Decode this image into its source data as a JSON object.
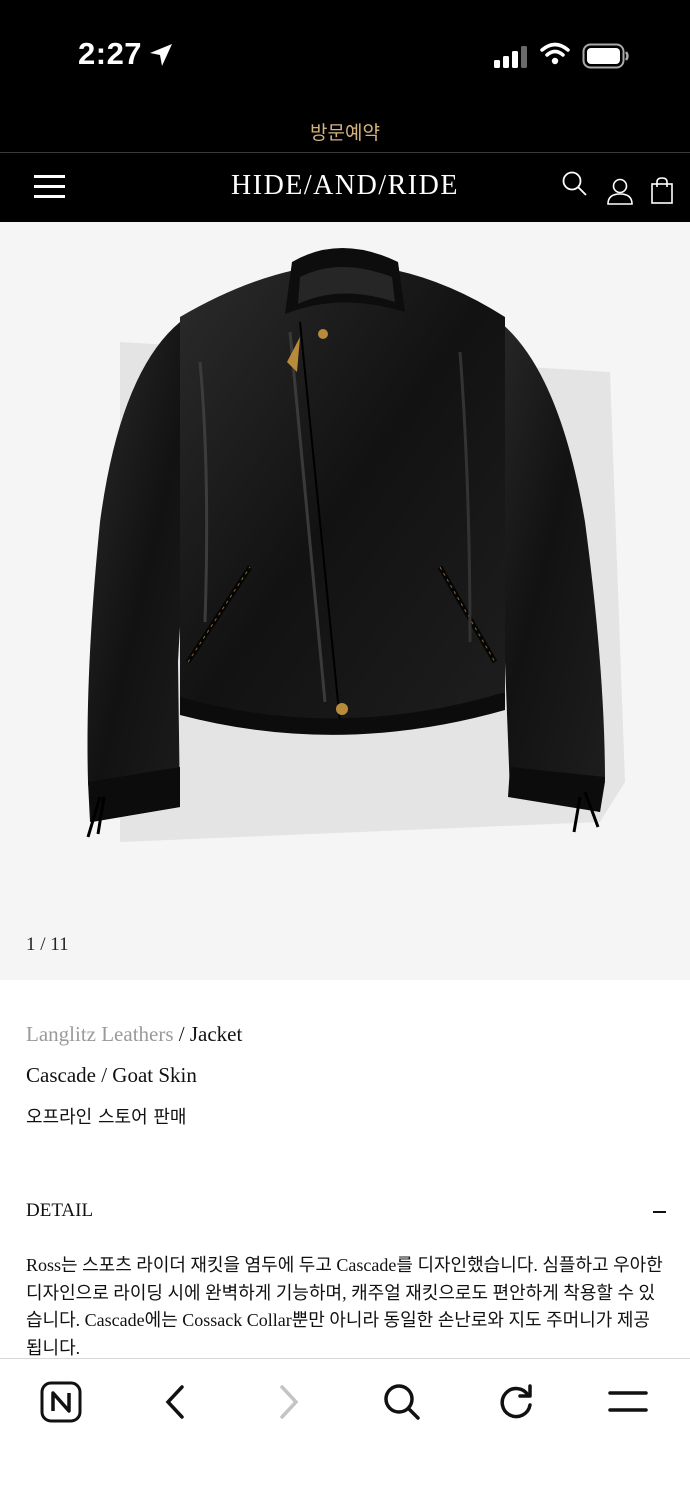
{
  "status_bar": {
    "time": "2:27",
    "icons": [
      "location-arrow-icon",
      "cellular-signal-icon",
      "wifi-icon",
      "battery-icon"
    ]
  },
  "reservation_link": "방문예약",
  "header": {
    "logo": "HIDE/AND/RIDE",
    "icons": [
      "menu-icon",
      "search-icon",
      "user-icon",
      "shopping-bag-icon"
    ]
  },
  "gallery": {
    "counter": "1 / 11",
    "image": "black-leather-jacket"
  },
  "product": {
    "brand": "Langlitz Leathers",
    "separator": " / ",
    "category": "Jacket",
    "name": "Cascade / Goat Skin",
    "availability": "오프라인 스토어 판매"
  },
  "detail": {
    "title": "DETAIL",
    "toggle_icon": "minus-icon",
    "text": "Ross는 스포츠 라이더 재킷을 염두에 두고 Cascade를 디자인했습니다. 심플하고 우아한 디자인으로 라이딩 시에 완벽하게 기능하며, 캐주얼 재킷으로도 편안하게 착용할 수 있습니다. Cascade에는 Cossack Collar뿐만 아니라 동일한 손난로와 지도 주머니가 제공됩니다."
  },
  "browser_toolbar": {
    "buttons": [
      "naver-home-icon",
      "back-icon",
      "forward-icon",
      "search-icon",
      "reload-icon",
      "menu-icon"
    ]
  },
  "colors": {
    "header_bg": "#000000",
    "reservation_text": "#d6b27c",
    "gallery_bg": "#f5f5f5",
    "brand_gray": "#9a9a9a"
  }
}
